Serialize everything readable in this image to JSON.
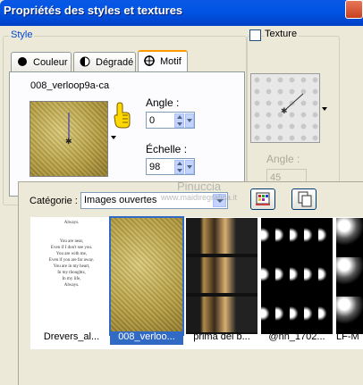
{
  "window": {
    "title": "Propriétés des styles et textures"
  },
  "style_group": {
    "legend": "Style"
  },
  "tabs": [
    {
      "label": "Couleur",
      "icon": "filled-circle-icon"
    },
    {
      "label": "Dégradé",
      "icon": "half-circle-icon"
    },
    {
      "label": "Motif",
      "icon": "pattern-crosshair-icon"
    }
  ],
  "pattern": {
    "name": "008_verloop9a-ca",
    "angle_label": "Angle :",
    "angle_value": "0",
    "scale_label": "Échelle :",
    "scale_value": "98"
  },
  "texture": {
    "label": "Texture",
    "checked": false,
    "angle_label": "Angle :",
    "angle_value": "45"
  },
  "category": {
    "label": "Catégorie :",
    "value": "Images ouvertes"
  },
  "watermark": {
    "line1": "Pinuccia",
    "line2": "www.maidiregrafica.it"
  },
  "thumbnails": [
    {
      "caption": "Drevers_al...",
      "text_lines": [
        "Always.",
        "",
        "You are near,",
        "Even if I don't see you.",
        "You are with me,",
        "Even if you are far away.",
        "You are in my heart,",
        "In my thoughts,",
        "In my life,",
        "Always."
      ]
    },
    {
      "caption": "008_verloo...",
      "selected": true
    },
    {
      "caption": "prima dei b..."
    },
    {
      "caption": "@nn_1702..."
    },
    {
      "caption": "LF-M"
    }
  ],
  "colors": {
    "title_bar": "#0054e3",
    "selection": "#316ac5",
    "active_tab_accent": "#ff9900",
    "pattern_gold": "#b0993e"
  }
}
